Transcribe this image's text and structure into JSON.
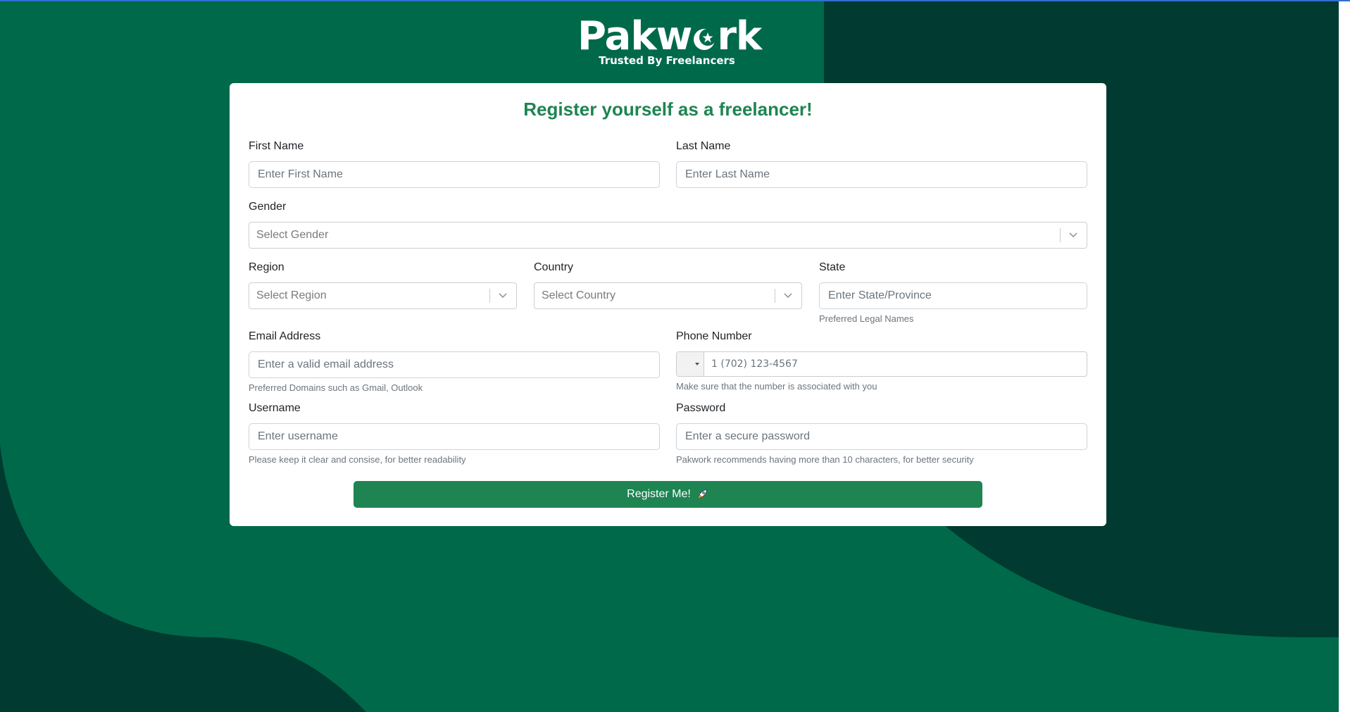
{
  "brand": {
    "name_left": "Pakw",
    "name_right": "rk",
    "tagline": "Trusted By Freelancers"
  },
  "form": {
    "title": "Register yourself as a freelancer!",
    "first_name": {
      "label": "First Name",
      "placeholder": "Enter First Name"
    },
    "last_name": {
      "label": "Last Name",
      "placeholder": "Enter Last Name"
    },
    "gender": {
      "label": "Gender",
      "placeholder": "Select Gender"
    },
    "region": {
      "label": "Region",
      "placeholder": "Select Region"
    },
    "country": {
      "label": "Country",
      "placeholder": "Select Country"
    },
    "state": {
      "label": "State",
      "placeholder": "Enter State/Province",
      "help": "Preferred Legal Names"
    },
    "email": {
      "label": "Email Address",
      "placeholder": "Enter a valid email address",
      "help": "Preferred Domains such as Gmail, Outlook"
    },
    "phone": {
      "label": "Phone Number",
      "placeholder": "1 (702) 123-4567",
      "help": "Make sure that the number is associated with you"
    },
    "username": {
      "label": "Username",
      "placeholder": "Enter username",
      "help": "Please keep it clear and consise, for better readability"
    },
    "password": {
      "label": "Password",
      "placeholder": "Enter a secure password",
      "help": "Pakwork recommends having more than 10 characters, for better security"
    },
    "submit_label": "Register Me!"
  },
  "colors": {
    "background": "#00694a",
    "background_dark": "#003a30",
    "accent": "#1e8452",
    "card": "#ffffff"
  },
  "icons": {
    "logo_o": "crescent-star-icon",
    "submit": "rocket-icon",
    "select": "chevron-down-icon",
    "phone": "country-flag-dropdown"
  }
}
